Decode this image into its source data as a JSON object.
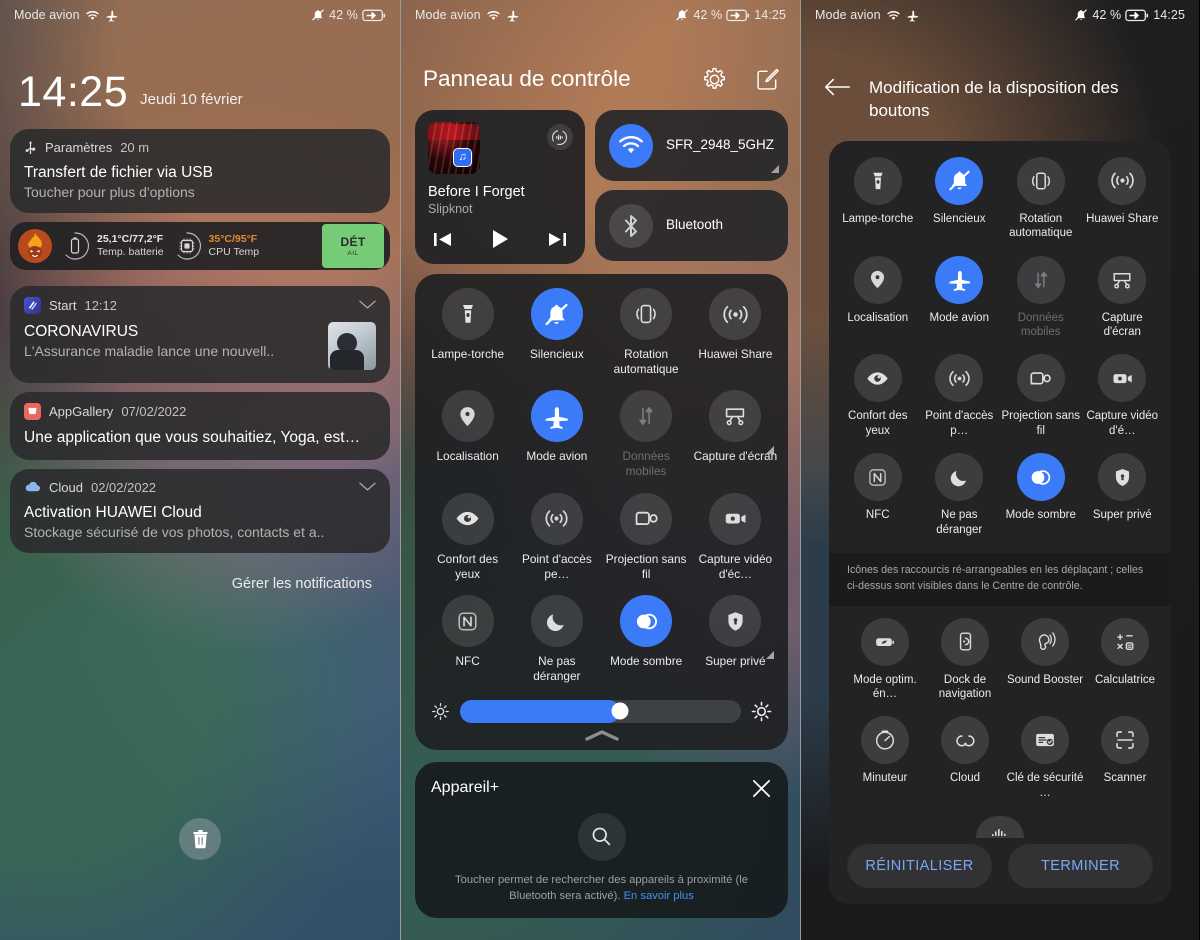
{
  "statusbar": {
    "mode_label": "Mode avion",
    "battery_percent": "42 %",
    "time": "14:25",
    "icons": [
      "wifi-icon",
      "airplane-icon",
      "bell-muted-icon",
      "battery-charging-icon"
    ]
  },
  "panel1": {
    "lock": {
      "time": "14:25",
      "date": "Jeudi 10 février"
    },
    "usb_card": {
      "app": "Paramètres",
      "time": "20 m",
      "title": "Transfert de fichier via USB",
      "subtitle": "Toucher pour plus d'options"
    },
    "performance": {
      "battery_temp_value": "25,1°C/77,2°F",
      "battery_temp_label": "Temp. batterie",
      "cpu_temp_value": "35°C/95°F",
      "cpu_temp_label": "CPU Temp",
      "button_main": "DÉT",
      "button_sub": "AIL",
      "button_color": "#76cb76"
    },
    "notifications": [
      {
        "app": "Start",
        "time": "12:12",
        "title": "CORONAVIRUS",
        "subtitle": "L'Assurance maladie lance une nouvell..",
        "has_chevron": true,
        "has_thumb": true
      },
      {
        "app": "AppGallery",
        "time": "07/02/2022",
        "title": "Une application que vous souhaitiez, Yoga, est…",
        "subtitle": "",
        "has_chevron": false,
        "has_thumb": false
      },
      {
        "app": "Cloud",
        "time": "02/02/2022",
        "title": "Activation HUAWEI Cloud",
        "subtitle": "Stockage sécurisé de vos photos, contacts et a..",
        "has_chevron": true,
        "has_thumb": false
      }
    ],
    "manage_notifications": "Gérer les notifications",
    "clear_all_icon": "trash-icon"
  },
  "panel2": {
    "title": "Panneau de contrôle",
    "header_icons": [
      "gear-icon",
      "edit-icon"
    ],
    "media": {
      "track_title": "Before I Forget",
      "artist": "Slipknot",
      "controls": [
        "previous-icon",
        "play-icon",
        "next-icon"
      ],
      "cast_icon": "sound-output-icon",
      "app_badge": "music-icon"
    },
    "network": [
      {
        "label": "SFR_2948_5GHZ",
        "icon": "wifi-icon",
        "active": true,
        "has_corner": true
      },
      {
        "label": "Bluetooth",
        "icon": "bluetooth-icon",
        "active": false,
        "has_corner": false
      }
    ],
    "tiles": [
      {
        "label": "Lampe-torche",
        "icon": "flashlight-icon",
        "state": "off"
      },
      {
        "label": "Silencieux",
        "icon": "bell-muted-icon",
        "state": "on"
      },
      {
        "label": "Rotation automatique",
        "icon": "rotation-icon",
        "state": "off"
      },
      {
        "label": "Huawei Share",
        "icon": "huawei-share-icon",
        "state": "off"
      },
      {
        "label": "Localisation",
        "icon": "location-icon",
        "state": "off"
      },
      {
        "label": "Mode avion",
        "icon": "airplane-icon",
        "state": "on"
      },
      {
        "label": "Données mobiles",
        "icon": "mobile-data-icon",
        "state": "disabled"
      },
      {
        "label": "Capture d'écran",
        "icon": "screenshot-icon",
        "state": "off",
        "corner": true
      },
      {
        "label": "Confort des yeux",
        "icon": "eye-comfort-icon",
        "state": "off"
      },
      {
        "label": "Point d'accès pe…",
        "icon": "hotspot-icon",
        "state": "off"
      },
      {
        "label": "Projection sans fil",
        "icon": "cast-icon",
        "state": "off"
      },
      {
        "label": "Capture vidéo d'éc…",
        "icon": "screen-record-icon",
        "state": "off"
      },
      {
        "label": "NFC",
        "icon": "nfc-icon",
        "state": "off"
      },
      {
        "label": "Ne pas déranger",
        "icon": "moon-icon",
        "state": "off"
      },
      {
        "label": "Mode sombre",
        "icon": "dark-mode-icon",
        "state": "on"
      },
      {
        "label": "Super privé",
        "icon": "shield-lock-icon",
        "state": "off",
        "corner": true
      }
    ],
    "brightness": {
      "value_percent": 57,
      "left_icon": "brightness-low-icon",
      "right_icon": "brightness-high-icon",
      "accent": "#3b7bf7"
    },
    "device_plus": {
      "title": "Appareil+",
      "close_icon": "close-icon",
      "search_icon": "search-icon",
      "hint": "Toucher permet de rechercher des appareils à proximité (le Bluetooth sera activé).",
      "link": "En savoir plus"
    }
  },
  "panel3": {
    "back_icon": "arrow-left-icon",
    "title": "Modification de la disposition des boutons",
    "active_tiles": [
      {
        "label": "Lampe-torche",
        "icon": "flashlight-icon",
        "state": "off"
      },
      {
        "label": "Silencieux",
        "icon": "bell-muted-icon",
        "state": "on"
      },
      {
        "label": "Rotation automatique",
        "icon": "rotation-icon",
        "state": "off"
      },
      {
        "label": "Huawei Share",
        "icon": "huawei-share-icon",
        "state": "off"
      },
      {
        "label": "Localisation",
        "icon": "location-icon",
        "state": "off"
      },
      {
        "label": "Mode avion",
        "icon": "airplane-icon",
        "state": "on"
      },
      {
        "label": "Données mobiles",
        "icon": "mobile-data-icon",
        "state": "disabled"
      },
      {
        "label": "Capture d'écran",
        "icon": "screenshot-icon",
        "state": "off"
      },
      {
        "label": "Confort des yeux",
        "icon": "eye-comfort-icon",
        "state": "off"
      },
      {
        "label": "Point d'accès p…",
        "icon": "hotspot-icon",
        "state": "off"
      },
      {
        "label": "Projection sans fil",
        "icon": "cast-icon",
        "state": "off"
      },
      {
        "label": "Capture vidéo d'é…",
        "icon": "screen-record-icon",
        "state": "off"
      },
      {
        "label": "NFC",
        "icon": "nfc-icon",
        "state": "off"
      },
      {
        "label": "Ne pas déranger",
        "icon": "moon-icon",
        "state": "off"
      },
      {
        "label": "Mode sombre",
        "icon": "dark-mode-icon",
        "state": "on"
      },
      {
        "label": "Super privé",
        "icon": "shield-lock-icon",
        "state": "off"
      }
    ],
    "note": "Icônes des raccourcis ré-arrangeables en les déplaçant ; celles ci-dessus sont visibles dans le Centre de contrôle.",
    "available_tiles": [
      {
        "label": "Mode optim. én…",
        "icon": "battery-saver-icon"
      },
      {
        "label": "Dock de navigation",
        "icon": "nav-dock-icon"
      },
      {
        "label": "Sound Booster",
        "icon": "sound-booster-icon"
      },
      {
        "label": "Calculatrice",
        "icon": "calculator-icon"
      },
      {
        "label": "Minuteur",
        "icon": "timer-icon"
      },
      {
        "label": "Cloud",
        "icon": "cloud-icon"
      },
      {
        "label": "Clé de sécurité …",
        "icon": "security-key-icon"
      },
      {
        "label": "Scanner",
        "icon": "scanner-icon"
      }
    ],
    "buttons": {
      "reset": "RÉINITIALISER",
      "done": "TERMINER",
      "color": "#7aa7f5"
    }
  }
}
